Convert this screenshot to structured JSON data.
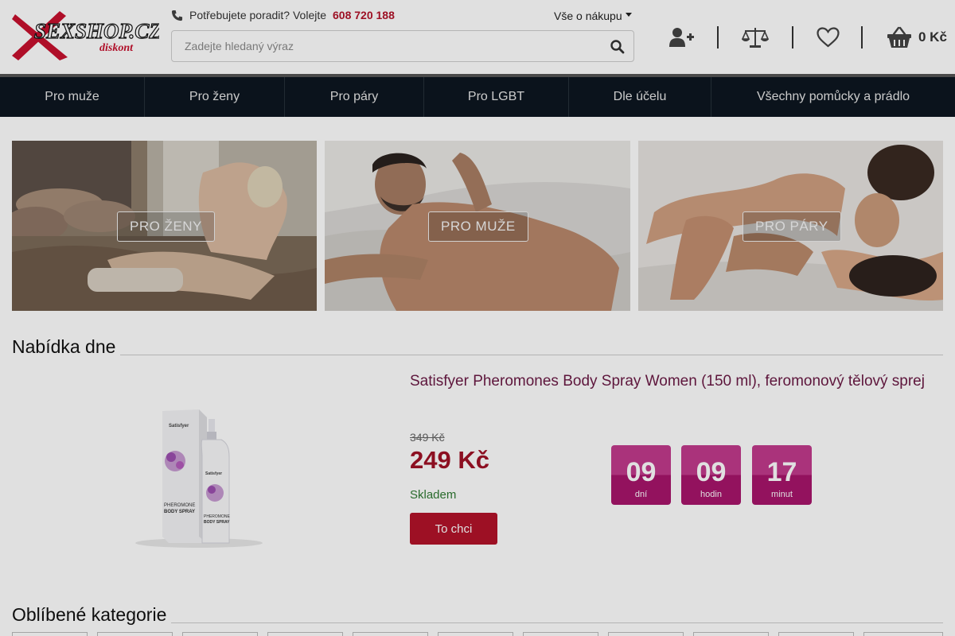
{
  "header": {
    "logo_text": "SEXSHOP.CZ",
    "logo_sub": "diskont",
    "help_text": "Potřebujete poradit? Volejte",
    "phone": "608 720 188",
    "shop_info": "Vše o nákupu",
    "search_placeholder": "Zadejte hledaný výraz",
    "cart_total": "0 Kč"
  },
  "nav": [
    "Pro muže",
    "Pro ženy",
    "Pro páry",
    "Pro LGBT",
    "Dle účelu",
    "Všechny pomůcky a prádlo"
  ],
  "banners": [
    "PRO ŽENY",
    "PRO MUŽE",
    "PRO PÁRY"
  ],
  "offer": {
    "section_title": "Nabídka dne",
    "product_title": "Satisfyer Pheromones Body Spray Women (150 ml), feromonový tělový sprej",
    "old_price": "349 Kč",
    "price": "249 Kč",
    "stock": "Skladem",
    "buy_label": "To chci",
    "countdown": [
      {
        "value": "09",
        "unit": "dní"
      },
      {
        "value": "09",
        "unit": "hodin"
      },
      {
        "value": "17",
        "unit": "minut"
      }
    ],
    "product_box_brand": "Satisfyer",
    "product_box_text1": "PHEROMONE",
    "product_box_text2": "BODY SPRAY"
  },
  "categories_title": "Oblíbené kategorie",
  "colors": {
    "accent_red": "#b3132a",
    "nav_bg": "#0d1620",
    "offer_title": "#6b1a45",
    "countdown": "#a8156c",
    "stock_green": "#2f7a33"
  }
}
